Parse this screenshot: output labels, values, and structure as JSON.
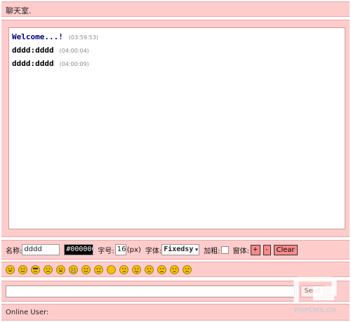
{
  "title": "聊天室.",
  "messages": [
    {
      "who": "Welcome...!",
      "time": "(03:59:53)",
      "system": true
    },
    {
      "who": "dddd:dddd",
      "time": "(04:00:04)",
      "system": false
    },
    {
      "who": "dddd:dddd",
      "time": "(04:00:09)",
      "system": false
    }
  ],
  "controls": {
    "name_label": "名称:",
    "name_value": "dddd",
    "color_value": "#000000",
    "size_label": "字号:",
    "size_value": "16",
    "size_unit": "(px)",
    "font_label": "字体:",
    "font_value": "Fixedsy",
    "bold_label": "加粗:",
    "window_label": "窗体:",
    "plus_label": "+",
    "minus_label": "-",
    "clear_label": "Clear"
  },
  "emoticons": [
    "grin",
    "squint",
    "cool",
    "angry",
    "laugh",
    "grimace",
    "smile",
    "wink",
    "neutral",
    "smirk",
    "tongue",
    "worried",
    "frown",
    "cross",
    "flat"
  ],
  "send_label": "Send",
  "online_label": "Online User:",
  "watermark_text": "PHPCMS.CN",
  "colors": {
    "panel": "#ffcccc",
    "border": "#e8a8a8",
    "button": "#ff8a8a",
    "emoticon": "#f2c200"
  }
}
